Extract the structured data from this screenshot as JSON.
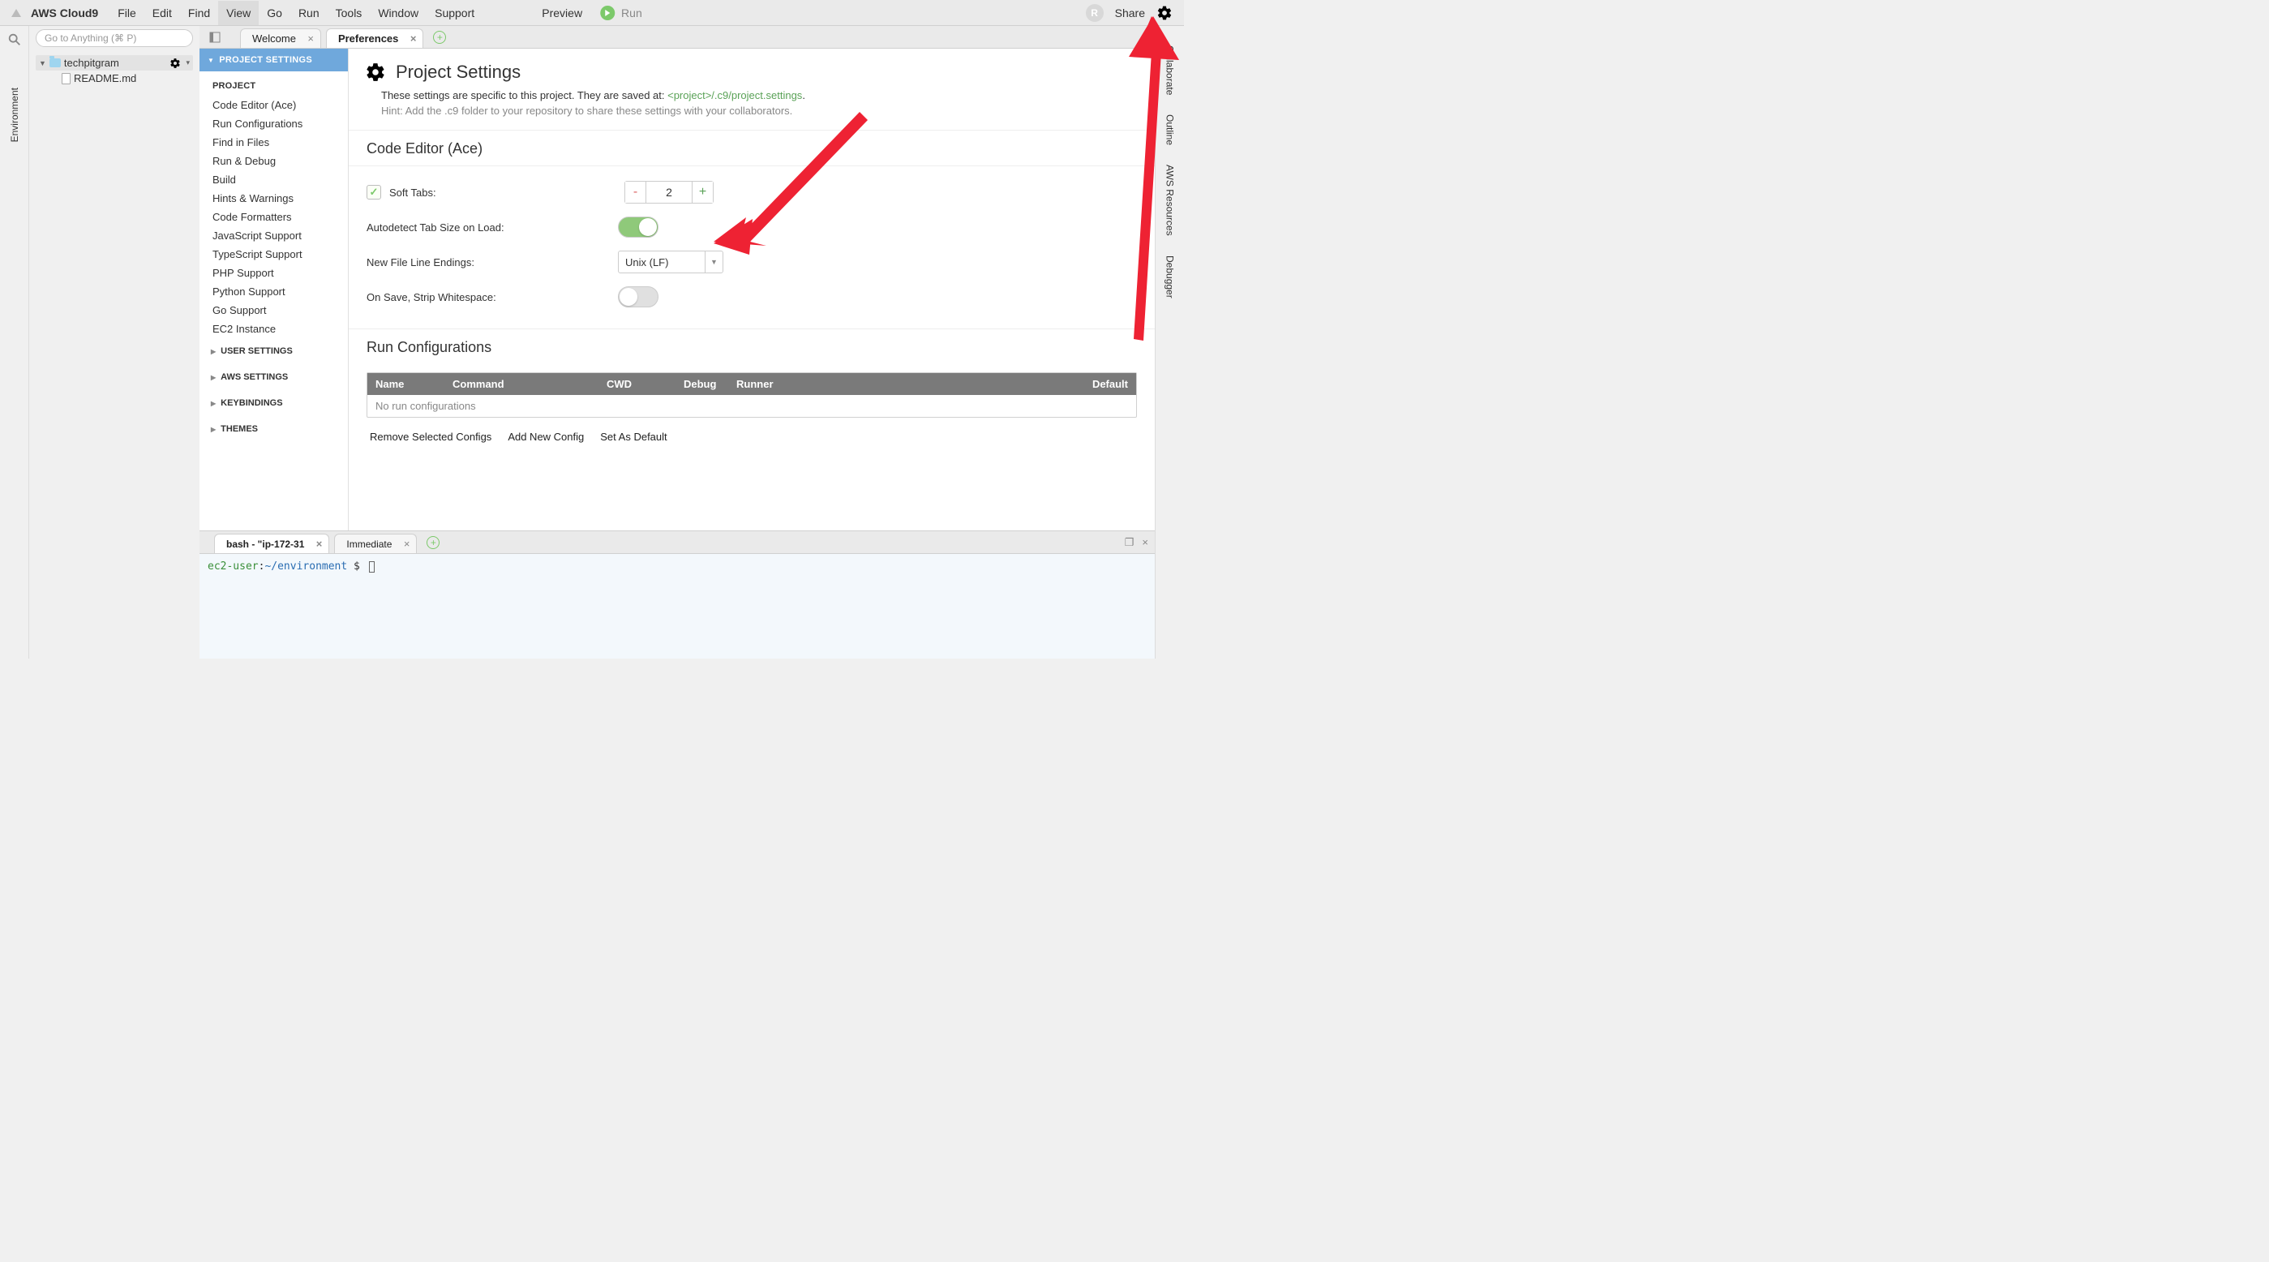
{
  "brand": "AWS Cloud9",
  "menu": [
    "File",
    "Edit",
    "Find",
    "View",
    "Go",
    "Run",
    "Tools",
    "Window",
    "Support"
  ],
  "active_menu": "View",
  "preview_label": "Preview",
  "run_label": "Run",
  "share_label": "Share",
  "avatar_initial": "R",
  "goto_placeholder": "Go to Anything (⌘ P)",
  "left_rail_label": "Environment",
  "right_rail_labels": [
    "Collaborate",
    "Outline",
    "AWS Resources",
    "Debugger"
  ],
  "tree": {
    "root": "techpitgram",
    "children": [
      {
        "name": "README.md"
      }
    ]
  },
  "tabs": [
    {
      "label": "Welcome",
      "closable": true,
      "active": false
    },
    {
      "label": "Preferences",
      "closable": true,
      "active": true
    }
  ],
  "pref_sidebar": {
    "active_section": "PROJECT SETTINGS",
    "group_title": "PROJECT",
    "links": [
      "Code Editor (Ace)",
      "Run Configurations",
      "Find in Files",
      "Run & Debug",
      "Build",
      "Hints & Warnings",
      "Code Formatters",
      "JavaScript Support",
      "TypeScript Support",
      "PHP Support",
      "Python Support",
      "Go Support",
      "EC2 Instance"
    ],
    "collapsed": [
      "USER SETTINGS",
      "AWS SETTINGS",
      "KEYBINDINGS",
      "THEMES"
    ]
  },
  "page": {
    "title": "Project Settings",
    "desc_prefix": "These settings are specific to this project. They are saved at: ",
    "desc_path": "<project>/.c9/project.settings",
    "desc_suffix": ".",
    "hint": "Hint: Add the .c9 folder to your repository to share these settings with your collaborators.",
    "section_editor": "Code Editor (Ace)",
    "soft_tabs_label": "Soft Tabs:",
    "soft_tabs_value": "2",
    "autodetect_label": "Autodetect Tab Size on Load:",
    "autodetect_on": true,
    "newfile_label": "New File Line Endings:",
    "newfile_value": "Unix (LF)",
    "strip_label": "On Save, Strip Whitespace:",
    "strip_on": false,
    "section_runcfg": "Run Configurations",
    "runcfg_cols": [
      "Name",
      "Command",
      "CWD",
      "Debug",
      "Runner",
      "Default"
    ],
    "runcfg_empty": "No run configurations",
    "runcfg_actions": [
      "Remove Selected Configs",
      "Add New Config",
      "Set As Default"
    ]
  },
  "bottom": {
    "tabs": [
      {
        "label": "bash - \"ip-172-31",
        "closable": true,
        "active": true
      },
      {
        "label": "Immediate",
        "closable": true,
        "active": false
      }
    ],
    "term_user": "ec2-user",
    "term_sep1": ":",
    "term_path": "~/environment",
    "term_prompt": " $ "
  }
}
